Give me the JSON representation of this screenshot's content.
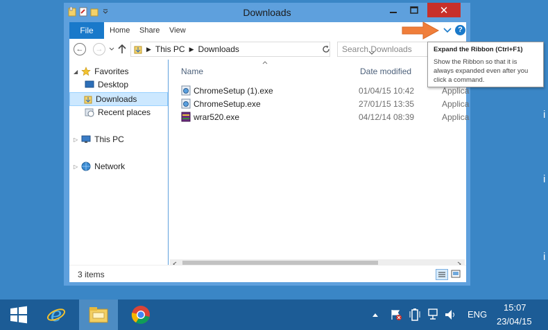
{
  "window": {
    "title": "Downloads",
    "controls": {
      "minimize": "–",
      "maximize": "□",
      "close": "✕"
    }
  },
  "ribbon": {
    "tabs": [
      "File",
      "Home",
      "Share",
      "View"
    ],
    "help_label": "?"
  },
  "address_bar": {
    "path": [
      "This PC",
      "Downloads"
    ],
    "search_placeholder": "Search Downloads"
  },
  "navigation_pane": {
    "items": [
      {
        "label": "Favorites",
        "icon": "star-icon"
      },
      {
        "label": "Desktop",
        "icon": "desktop-icon"
      },
      {
        "label": "Downloads",
        "icon": "downloads-folder-icon",
        "selected": true
      },
      {
        "label": "Recent places",
        "icon": "recent-places-icon"
      },
      {
        "label": "This PC",
        "icon": "computer-icon"
      },
      {
        "label": "Network",
        "icon": "network-icon"
      }
    ]
  },
  "file_list": {
    "columns": [
      "Name",
      "Date modified"
    ],
    "rows": [
      {
        "name": "ChromeSetup (1).exe",
        "date": "01/04/15 10:42",
        "type": "Applica",
        "icon": "setup-exe-icon"
      },
      {
        "name": "ChromeSetup.exe",
        "date": "27/01/15 13:35",
        "type": "Applica",
        "icon": "setup-exe-icon"
      },
      {
        "name": "wrar520.exe",
        "date": "04/12/14 08:39",
        "type": "Applica",
        "icon": "winrar-icon"
      }
    ]
  },
  "status_bar": {
    "item_count": "3 items"
  },
  "tooltip": {
    "title": "Expand the Ribbon (Ctrl+F1)",
    "body": "Show the Ribbon so that it is always expanded even after you click a command."
  },
  "taskbar": {
    "language": "ENG",
    "time": "15:07",
    "date": "23/04/15"
  },
  "colors": {
    "desktop": "#3a86c6",
    "window_frame": "#5ea0dd",
    "file_tab": "#1979ca",
    "close_button": "#c7302a",
    "arrow": "#f07e3a",
    "taskbar": "#1c5c96"
  }
}
